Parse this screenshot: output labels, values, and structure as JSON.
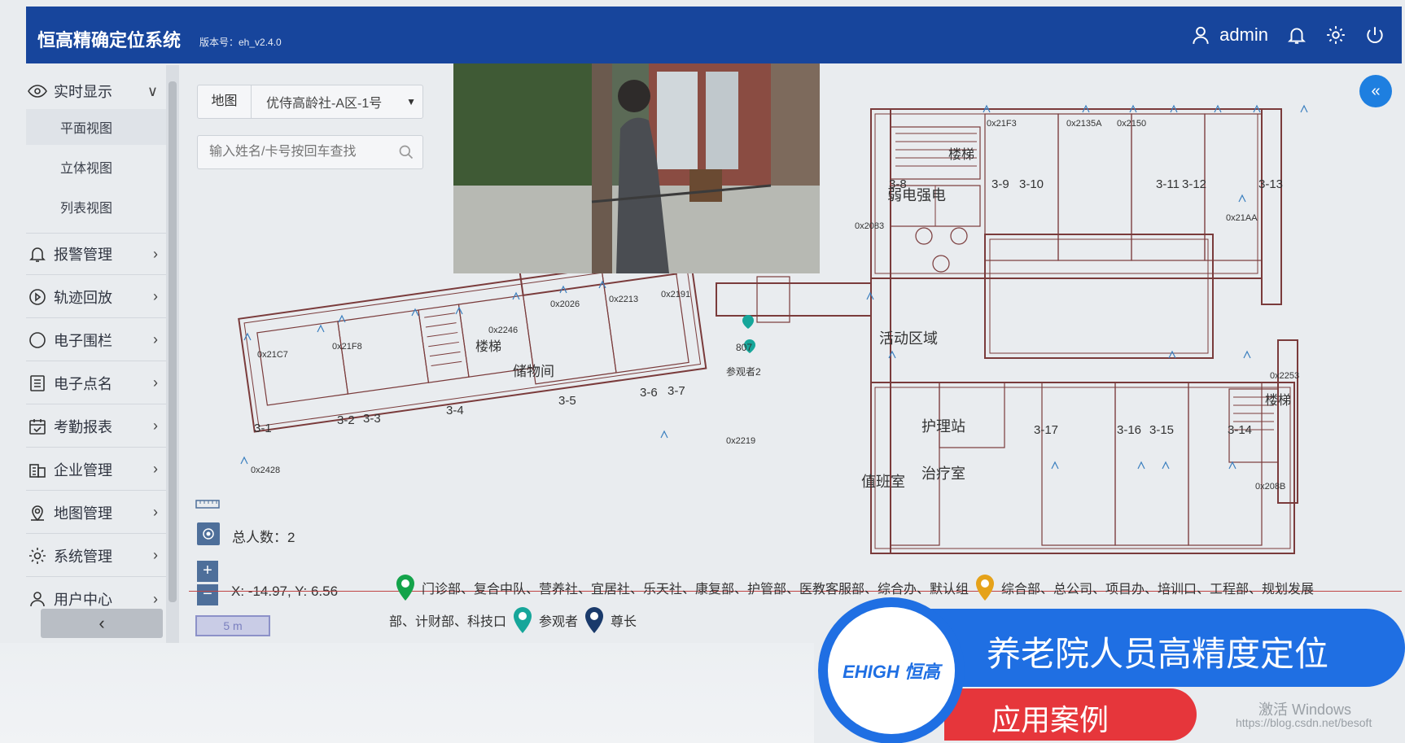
{
  "header": {
    "title": "恒高精确定位系统",
    "version": "版本号：eh_v2.4.0",
    "username": "admin",
    "brand_color": "#17459c"
  },
  "sidebar": {
    "groups": [
      {
        "label": "实时显示",
        "icon": "eye-icon",
        "expanded": true
      },
      {
        "label": "报警管理",
        "icon": "bell-icon"
      },
      {
        "label": "轨迹回放",
        "icon": "replay-icon"
      },
      {
        "label": "电子围栏",
        "icon": "circle-icon"
      },
      {
        "label": "电子点名",
        "icon": "list-icon"
      },
      {
        "label": "考勤报表",
        "icon": "calendar-icon"
      },
      {
        "label": "企业管理",
        "icon": "building-icon"
      },
      {
        "label": "地图管理",
        "icon": "map-pin-icon"
      },
      {
        "label": "系统管理",
        "icon": "gear-icon"
      },
      {
        "label": "用户中心",
        "icon": "user-icon"
      }
    ],
    "subitems": [
      "平面视图",
      "立体视图",
      "列表视图"
    ]
  },
  "controls": {
    "map_label": "地图",
    "map_value": "优侍高龄社-A区-1号",
    "search_placeholder": "输入姓名/卡号按回车查找"
  },
  "map": {
    "rooms": {
      "stairs_right": "楼梯",
      "weak_power": "弱电强电",
      "activity": "活动区域",
      "nurse_station": "护理站",
      "duty_room": "值班室",
      "treatment": "治疗室",
      "storage": "储物间",
      "stairs_left": "楼梯",
      "stairs_br": "楼梯"
    },
    "room_numbers": [
      "3-8",
      "3-9",
      "3-10",
      "3-11",
      "3-12",
      "3-13",
      "3-1",
      "3-2",
      "3-3",
      "3-4",
      "3-5",
      "3-6",
      "3-7",
      "3-17",
      "3-16",
      "3-15",
      "3-14"
    ],
    "anchors": [
      "0x2083",
      "0x21AA",
      "0x2428",
      "0x2026",
      "0x2191",
      "0x2253",
      "0x208B",
      "0x2219",
      "0x21C7",
      "0x21F8",
      "0x2246",
      "0x2213",
      "0x2150",
      "0x21F3",
      "0x2135A"
    ],
    "visitor_tags": [
      "807",
      "参观者2"
    ]
  },
  "footer": {
    "total_label": "总人数：",
    "total_value": "2",
    "coords": "X: -14.97, Y: 6.56",
    "scale": "5 m",
    "legend": {
      "green_text": "门诊部、复合中队、营养社、宜居社、乐天社、康复部、护管部、医教客服部、综合办、默认组",
      "orange_text": "综合部、总公司、项目办、培训口、工程部、规划发展",
      "orange_text_cont": "部、计财部、科技口",
      "teal_text": "参观者",
      "navy_text": "尊长",
      "colors": {
        "green": "#13a34a",
        "orange": "#e5a21a",
        "teal": "#16a69a",
        "navy": "#1a3a6b"
      }
    }
  },
  "banner": {
    "logo": "EHIGH 恒高",
    "title": "养老院人员高精度定位",
    "subtitle": "应用案例",
    "watermark": "激活 Windows",
    "watermark2": "https://blog.csdn.net/besoft"
  }
}
